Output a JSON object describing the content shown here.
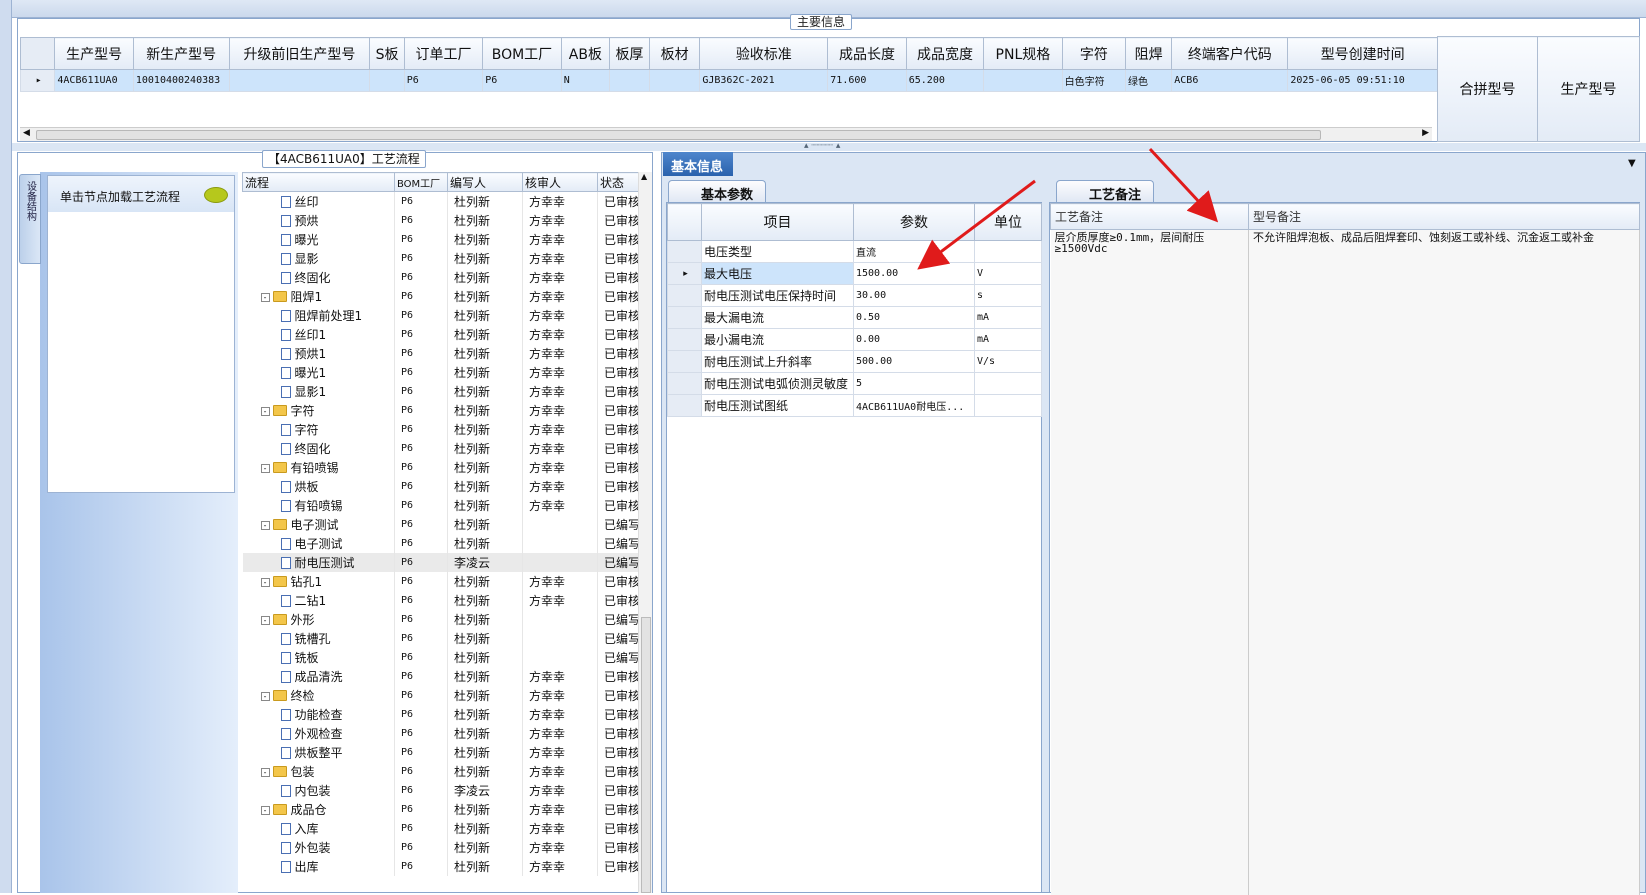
{
  "main_info": {
    "legend": "主要信息",
    "columns": [
      "生产型号",
      "新生产型号",
      "升级前旧生产型号",
      "S板",
      "订单工厂",
      "BOM工厂",
      "AB板",
      "板厚",
      "板材",
      "验收标准",
      "成品长度",
      "成品宽度",
      "PNL规格",
      "字符",
      "阻焊",
      "终端客户代码",
      "型号创建时间"
    ],
    "row": [
      "4ACB611UA0",
      "10010400240383",
      "",
      "",
      "P6",
      "P6",
      "N",
      "",
      "",
      "GJB362C-2021",
      "71.600",
      "65.200",
      "",
      "白色字符",
      "绿色",
      "ACB6",
      "2025-06-05 09:51:10"
    ],
    "side_columns": [
      "合拼型号",
      "生产型号"
    ]
  },
  "flow": {
    "legend": "【4ACB611UA0】工艺流程",
    "vertical_tab": "设备结构",
    "load_hint": "单击节点加载工艺流程",
    "columns": [
      "流程",
      "BOM工厂",
      "编写人",
      "核审人",
      "状态"
    ],
    "rows": [
      {
        "name": "丝印",
        "level": 2,
        "type": "doc",
        "factory": "P6",
        "writer": "杜列新",
        "reviewer": "方幸幸",
        "status": "已审核"
      },
      {
        "name": "预烘",
        "level": 2,
        "type": "doc",
        "factory": "P6",
        "writer": "杜列新",
        "reviewer": "方幸幸",
        "status": "已审核"
      },
      {
        "name": "曝光",
        "level": 2,
        "type": "doc",
        "factory": "P6",
        "writer": "杜列新",
        "reviewer": "方幸幸",
        "status": "已审核"
      },
      {
        "name": "显影",
        "level": 2,
        "type": "doc",
        "factory": "P6",
        "writer": "杜列新",
        "reviewer": "方幸幸",
        "status": "已审核"
      },
      {
        "name": "终固化",
        "level": 2,
        "type": "doc",
        "factory": "P6",
        "writer": "杜列新",
        "reviewer": "方幸幸",
        "status": "已审核"
      },
      {
        "name": "阻焊1",
        "level": 1,
        "type": "folder",
        "factory": "P6",
        "writer": "杜列新",
        "reviewer": "方幸幸",
        "status": "已审核"
      },
      {
        "name": "阻焊前处理1",
        "level": 2,
        "type": "doc",
        "factory": "P6",
        "writer": "杜列新",
        "reviewer": "方幸幸",
        "status": "已审核"
      },
      {
        "name": "丝印1",
        "level": 2,
        "type": "doc",
        "factory": "P6",
        "writer": "杜列新",
        "reviewer": "方幸幸",
        "status": "已审核"
      },
      {
        "name": "预烘1",
        "level": 2,
        "type": "doc",
        "factory": "P6",
        "writer": "杜列新",
        "reviewer": "方幸幸",
        "status": "已审核"
      },
      {
        "name": "曝光1",
        "level": 2,
        "type": "doc",
        "factory": "P6",
        "writer": "杜列新",
        "reviewer": "方幸幸",
        "status": "已审核"
      },
      {
        "name": "显影1",
        "level": 2,
        "type": "doc",
        "factory": "P6",
        "writer": "杜列新",
        "reviewer": "方幸幸",
        "status": "已审核"
      },
      {
        "name": "字符",
        "level": 1,
        "type": "folder",
        "factory": "P6",
        "writer": "杜列新",
        "reviewer": "方幸幸",
        "status": "已审核"
      },
      {
        "name": "字符",
        "level": 2,
        "type": "doc",
        "factory": "P6",
        "writer": "杜列新",
        "reviewer": "方幸幸",
        "status": "已审核"
      },
      {
        "name": "终固化",
        "level": 2,
        "type": "doc",
        "factory": "P6",
        "writer": "杜列新",
        "reviewer": "方幸幸",
        "status": "已审核"
      },
      {
        "name": "有铅喷锡",
        "level": 1,
        "type": "folder",
        "factory": "P6",
        "writer": "杜列新",
        "reviewer": "方幸幸",
        "status": "已审核"
      },
      {
        "name": "烘板",
        "level": 2,
        "type": "doc",
        "factory": "P6",
        "writer": "杜列新",
        "reviewer": "方幸幸",
        "status": "已审核"
      },
      {
        "name": "有铅喷锡",
        "level": 2,
        "type": "doc",
        "factory": "P6",
        "writer": "杜列新",
        "reviewer": "方幸幸",
        "status": "已审核"
      },
      {
        "name": "电子测试",
        "level": 1,
        "type": "folder",
        "factory": "P6",
        "writer": "杜列新",
        "reviewer": "",
        "status": "已编写"
      },
      {
        "name": "电子测试",
        "level": 2,
        "type": "doc",
        "factory": "P6",
        "writer": "杜列新",
        "reviewer": "",
        "status": "已编写"
      },
      {
        "name": "耐电压测试",
        "level": 2,
        "type": "doc",
        "factory": "P6",
        "writer": "李凌云",
        "reviewer": "",
        "status": "已编写",
        "highlight": true
      },
      {
        "name": "钻孔1",
        "level": 1,
        "type": "folder",
        "factory": "P6",
        "writer": "杜列新",
        "reviewer": "方幸幸",
        "status": "已审核"
      },
      {
        "name": "二钻1",
        "level": 2,
        "type": "doc",
        "factory": "P6",
        "writer": "杜列新",
        "reviewer": "方幸幸",
        "status": "已审核"
      },
      {
        "name": "外形",
        "level": 1,
        "type": "folder",
        "factory": "P6",
        "writer": "杜列新",
        "reviewer": "",
        "status": "已编写"
      },
      {
        "name": "铣槽孔",
        "level": 2,
        "type": "doc",
        "factory": "P6",
        "writer": "杜列新",
        "reviewer": "",
        "status": "已编写"
      },
      {
        "name": "铣板",
        "level": 2,
        "type": "doc",
        "factory": "P6",
        "writer": "杜列新",
        "reviewer": "",
        "status": "已编写"
      },
      {
        "name": "成品清洗",
        "level": 2,
        "type": "doc",
        "factory": "P6",
        "writer": "杜列新",
        "reviewer": "方幸幸",
        "status": "已审核"
      },
      {
        "name": "终检",
        "level": 1,
        "type": "folder",
        "factory": "P6",
        "writer": "杜列新",
        "reviewer": "方幸幸",
        "status": "已审核"
      },
      {
        "name": "功能检查",
        "level": 2,
        "type": "doc",
        "factory": "P6",
        "writer": "杜列新",
        "reviewer": "方幸幸",
        "status": "已审核"
      },
      {
        "name": "外观检查",
        "level": 2,
        "type": "doc",
        "factory": "P6",
        "writer": "杜列新",
        "reviewer": "方幸幸",
        "status": "已审核"
      },
      {
        "name": "烘板整平",
        "level": 2,
        "type": "doc",
        "factory": "P6",
        "writer": "杜列新",
        "reviewer": "方幸幸",
        "status": "已审核"
      },
      {
        "name": "包装",
        "level": 1,
        "type": "folder",
        "factory": "P6",
        "writer": "杜列新",
        "reviewer": "方幸幸",
        "status": "已审核"
      },
      {
        "name": "内包装",
        "level": 2,
        "type": "doc",
        "factory": "P6",
        "writer": "李凌云",
        "reviewer": "方幸幸",
        "status": "已审核"
      },
      {
        "name": "成品仓",
        "level": 1,
        "type": "folder",
        "factory": "P6",
        "writer": "杜列新",
        "reviewer": "方幸幸",
        "status": "已审核"
      },
      {
        "name": "入库",
        "level": 2,
        "type": "doc",
        "factory": "P6",
        "writer": "杜列新",
        "reviewer": "方幸幸",
        "status": "已审核"
      },
      {
        "name": "外包装",
        "level": 2,
        "type": "doc",
        "factory": "P6",
        "writer": "杜列新",
        "reviewer": "方幸幸",
        "status": "已审核"
      },
      {
        "name": "出库",
        "level": 2,
        "type": "doc",
        "factory": "P6",
        "writer": "杜列新",
        "reviewer": "方幸幸",
        "status": "已审核"
      }
    ]
  },
  "basic": {
    "tab": "基本信息",
    "param_tab": "基本参数",
    "param_columns": [
      "项目",
      "参数",
      "单位"
    ],
    "params": [
      {
        "item": "电压类型",
        "value": "直流",
        "unit": ""
      },
      {
        "item": "最大电压",
        "value": "1500.00",
        "unit": "V",
        "current": true
      },
      {
        "item": "耐电压测试电压保持时间",
        "value": "30.00",
        "unit": "s"
      },
      {
        "item": "最大漏电流",
        "value": "0.50",
        "unit": "mA"
      },
      {
        "item": "最小漏电流",
        "value": "0.00",
        "unit": "mA"
      },
      {
        "item": "耐电压测试上升斜率",
        "value": "500.00",
        "unit": "V/s"
      },
      {
        "item": "耐电压测试电弧侦测灵敏度",
        "value": "5",
        "unit": ""
      },
      {
        "item": "耐电压测试图纸",
        "value": "4ACB611UA0耐电压...",
        "unit": ""
      }
    ],
    "note_tab": "工艺备注",
    "note_columns": [
      "工艺备注",
      "型号备注"
    ],
    "process_note": "层介质厚度≥0.1mm，层间耐压≥1500Vdc",
    "model_note": "不允许阻焊泡板、成品后阻焊套印、蚀刻返工或补线、沉金返工或补金"
  },
  "colors": {
    "arrow": "#e01b1b",
    "selected": "#cde4fb",
    "tab_active": "#2a62ad"
  }
}
